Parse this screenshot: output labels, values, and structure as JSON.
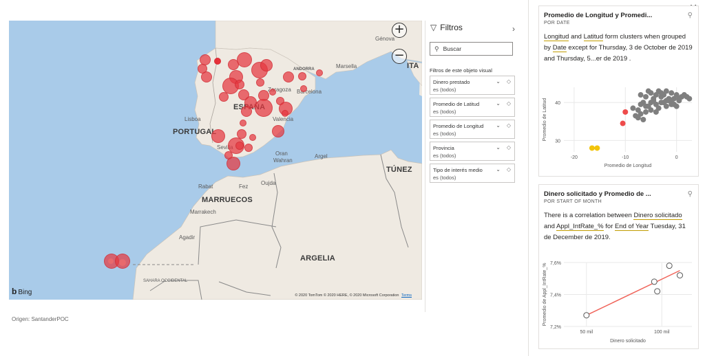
{
  "map": {
    "zoom_in_symbol": "+",
    "zoom_out_symbol": "−",
    "country_labels": [
      "ESPAÑA",
      "PORTUGAL",
      "MARRUECOS",
      "ARGELIA",
      "TÚNEZ",
      "ITA"
    ],
    "city_labels": [
      "Génova",
      "Marsella",
      "ANDORRA",
      "Zaragoza",
      "Barcelona",
      "Lisboa",
      "Valencia",
      "Sevilla",
      "Oran",
      "Wahran",
      "Argel",
      "Rabat",
      "Fez",
      "Oujda",
      "Marrakech",
      "Agadir",
      "SAHARA OCCIDENTAL"
    ],
    "bing_label": "Bing",
    "copyright": "© 2020 TomTom © 2020 HERE, © 2020 Microsoft Corporation",
    "terms": "Terms"
  },
  "origin": "Origen: SantanderPOC",
  "filters": {
    "title": "Filtros",
    "search_placeholder": "Buscar",
    "section_label": "Filtros de este objeto visual",
    "items": [
      {
        "name": "Dinero prestado",
        "state": "es (todos)"
      },
      {
        "name": "Promedio de Latitud",
        "state": "es (todos)"
      },
      {
        "name": "Promedio de Longitud",
        "state": "es (todos)"
      },
      {
        "name": "Provincia",
        "state": "es (todos)"
      },
      {
        "name": "Tipo de interés medio",
        "state": "es (todos)"
      }
    ]
  },
  "insights": {
    "card1": {
      "title": "Promedio de Longitud y Promedi...",
      "subtitle": "POR DATE",
      "desc_parts": [
        "Longitud",
        " and ",
        "Latitud",
        " form clusters when grouped by ",
        "Date",
        " except for Thursday, 3 de October de 2019 and Thursday, 5...er de 2019 ."
      ],
      "xlabel": "Promedio de Longitud",
      "ylabel": "Promedio de Latitud",
      "xticks": [
        "-20",
        "-10",
        "0"
      ],
      "yticks": [
        "40",
        "30"
      ]
    },
    "card2": {
      "title": "Dinero solicitado y Promedio de ...",
      "subtitle": "POR START OF MONTH",
      "desc_parts": [
        "There is a correlation between ",
        "Dinero solicitado",
        " and ",
        "Appl_IntRate_%",
        " for ",
        "End of Year",
        " Tuesday, 31 de December de 2019."
      ],
      "xlabel": "Dinero solicitado",
      "ylabel": "Promedio de Appl_IntRate_%",
      "xticks": [
        "50 mil",
        "100 mil"
      ],
      "yticks": [
        "7,6%",
        "7,4%",
        "7,2%"
      ]
    }
  },
  "colors": {
    "bubble": "#e53840",
    "cluster": "#7f7f7f",
    "outlier_red": "#ee4b4b",
    "outlier_yellow": "#f2c40b",
    "trend": "#f0645a",
    "sea": "#a9cbe9",
    "land": "#efeae2"
  },
  "chart_data": [
    {
      "type": "scatter",
      "title": "Promedio de Longitud y Promedi...",
      "subtitle": "POR DATE",
      "xlabel": "Promedio de Longitud",
      "ylabel": "Promedio de Latitud",
      "xlim": [
        -22,
        3
      ],
      "ylim": [
        27,
        44
      ],
      "series": [
        {
          "points": [
            [
              -7,
              42
            ],
            [
              -6,
              41.5
            ],
            [
              -5.5,
              43
            ],
            [
              -5,
              42.5
            ],
            [
              -4.5,
              41
            ],
            [
              -4,
              42
            ],
            [
              -3.5,
              43
            ],
            [
              -3,
              41.5
            ],
            [
              -2.5,
              42
            ],
            [
              -2,
              40.5
            ],
            [
              -1.5,
              41
            ],
            [
              -1,
              42.5
            ],
            [
              -0.5,
              41
            ],
            [
              0,
              42
            ],
            [
              0.5,
              40.5
            ],
            [
              1,
              41.5
            ],
            [
              1.5,
              42
            ],
            [
              -6.5,
              40
            ],
            [
              -6,
              39
            ],
            [
              -5,
              40
            ],
            [
              -4,
              39.5
            ],
            [
              -3,
              40
            ],
            [
              -2,
              39
            ],
            [
              -1,
              39.5
            ],
            [
              0,
              39
            ],
            [
              -7.5,
              38
            ],
            [
              -7,
              37
            ],
            [
              -6,
              37.5
            ],
            [
              -5,
              38
            ],
            [
              -4,
              37.5
            ],
            [
              -8,
              36.5
            ],
            [
              -7.5,
              36
            ],
            [
              -6.5,
              35.5
            ],
            [
              -3.5,
              38.5
            ],
            [
              -2.5,
              40
            ],
            [
              -1.5,
              40.5
            ],
            [
              0.5,
              41
            ],
            [
              -0.5,
              39.5
            ],
            [
              -5.5,
              39
            ],
            [
              -4.5,
              40.5
            ],
            [
              -3,
              42.5
            ],
            [
              -2,
              43
            ],
            [
              -8.5,
              38.5
            ],
            [
              -7,
              39.5
            ],
            [
              -1,
              40.5
            ],
            [
              2,
              41.5
            ],
            [
              2.5,
              41
            ]
          ]
        },
        {
          "points": [
            [
              -10,
              37.5
            ],
            [
              -10.5,
              34.5
            ]
          ]
        },
        {
          "points": [
            [
              -16.5,
              28
            ],
            [
              -15.5,
              28
            ]
          ]
        }
      ]
    },
    {
      "type": "scatter",
      "title": "Dinero solicitado y Promedio de ...",
      "subtitle": "POR START OF MONTH",
      "xlabel": "Dinero solicitado",
      "ylabel": "Promedio de Appl_IntRate_%",
      "xlim": [
        35000,
        120000
      ],
      "ylim": [
        7.2,
        7.6
      ],
      "points": [
        [
          50000,
          7.27
        ],
        [
          95000,
          7.48
        ],
        [
          97000,
          7.42
        ],
        [
          105000,
          7.58
        ],
        [
          112000,
          7.52
        ]
      ],
      "trendline": [
        [
          50000,
          7.27
        ],
        [
          112000,
          7.55
        ]
      ]
    }
  ]
}
